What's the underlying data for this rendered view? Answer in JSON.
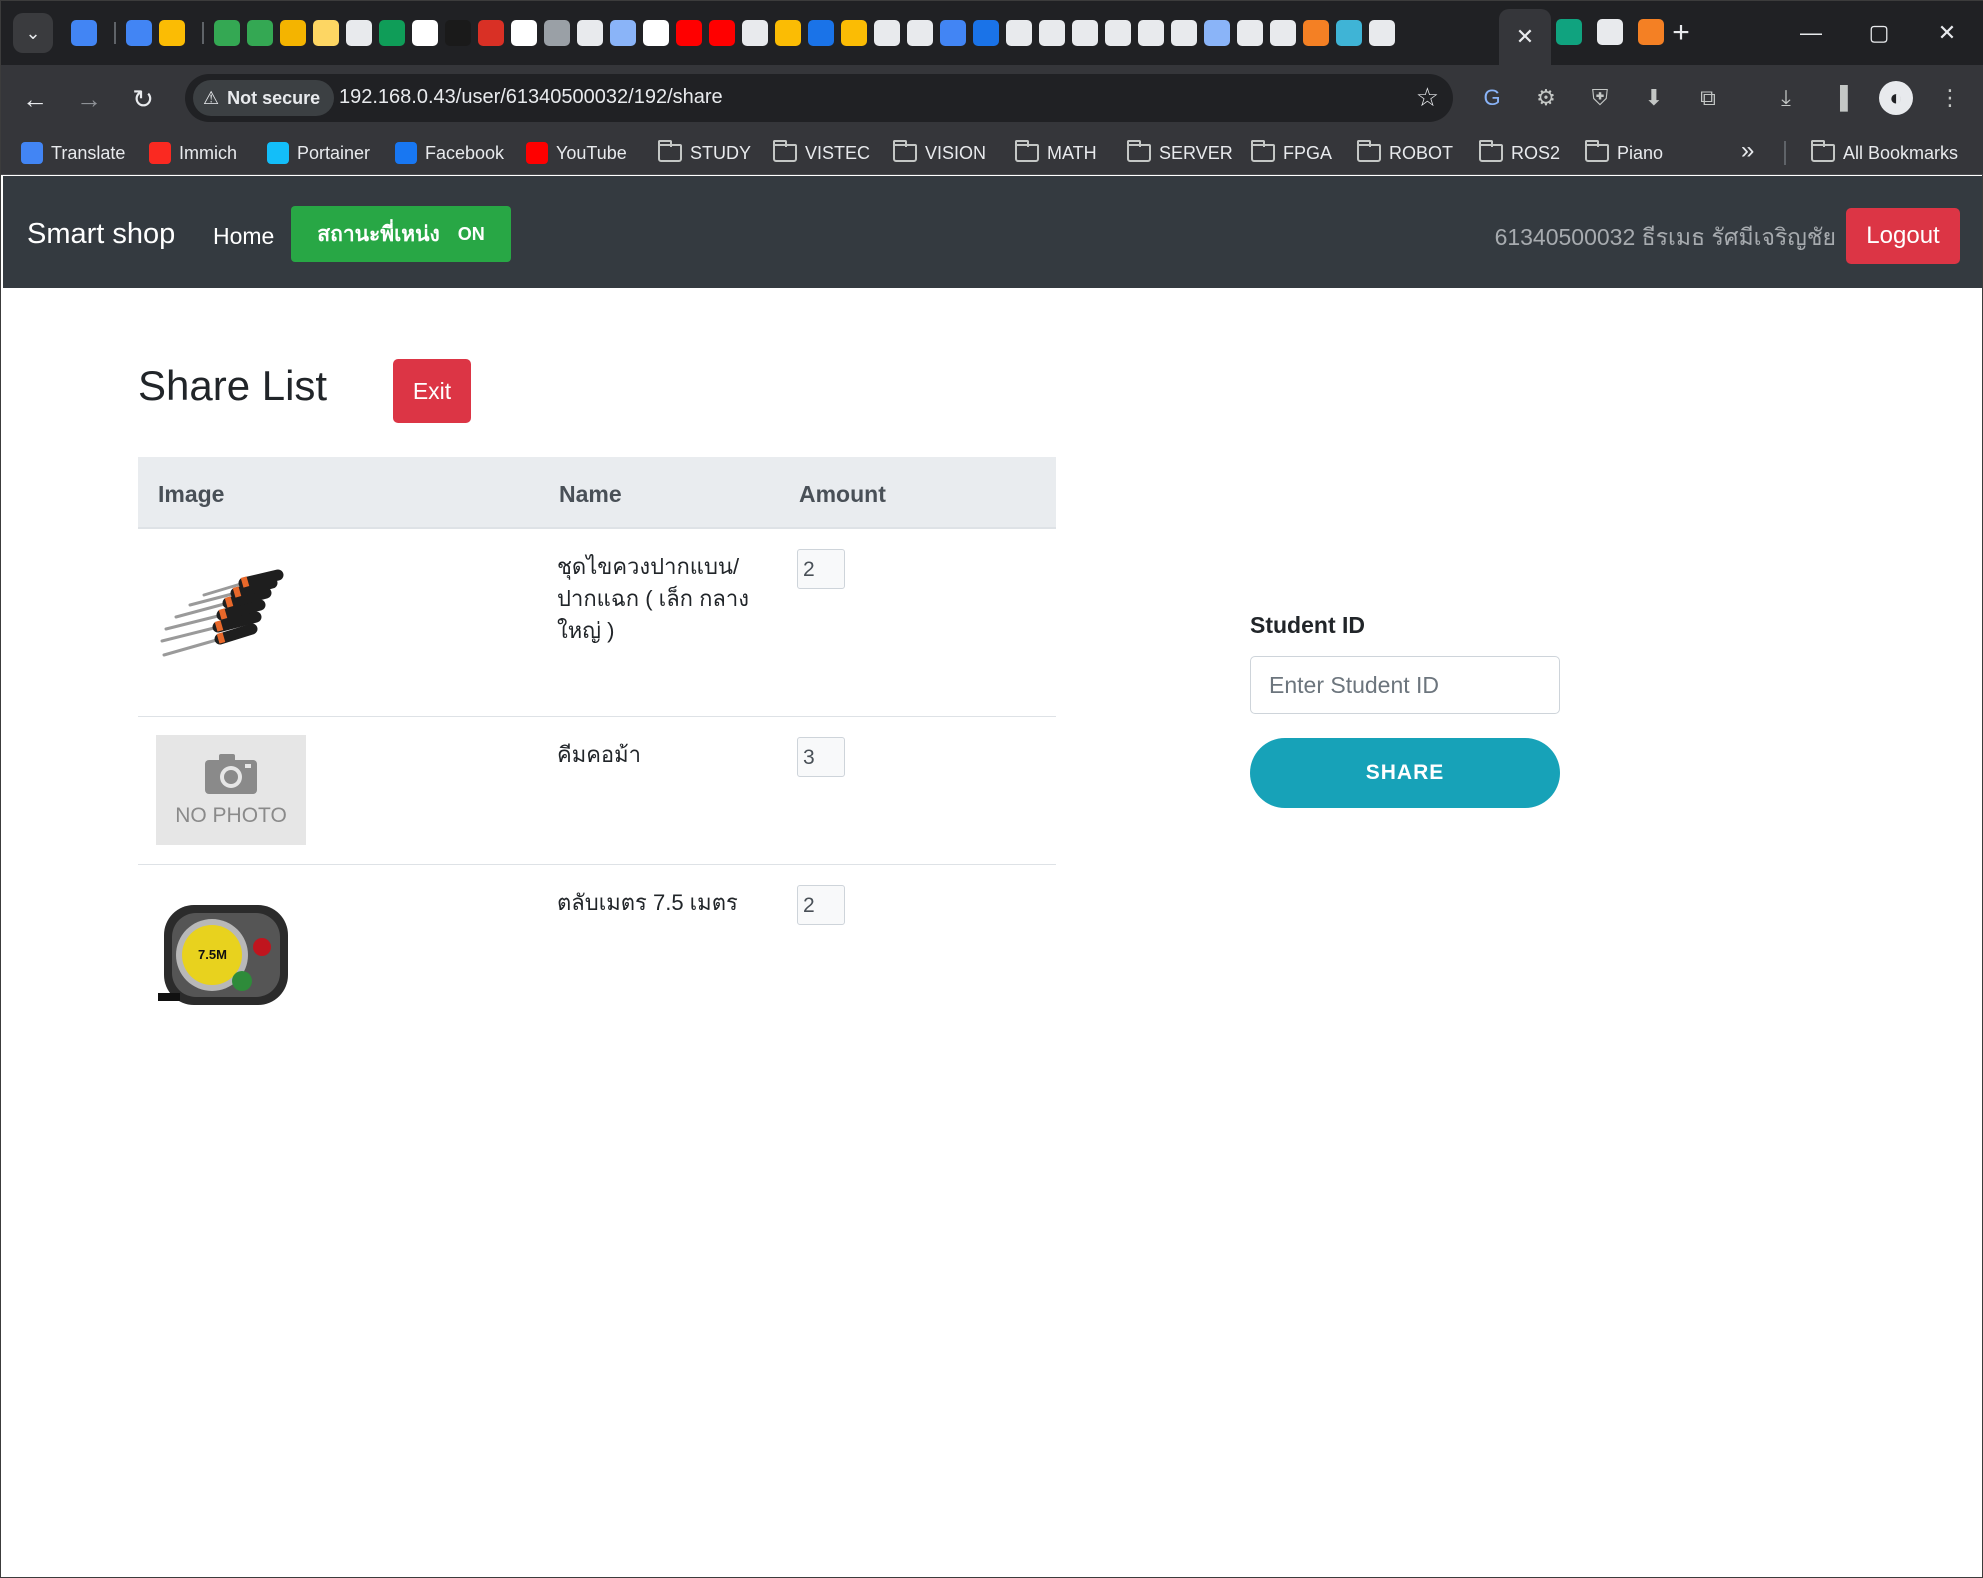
{
  "browser": {
    "active_tab_close": "✕",
    "new_tab": "+",
    "win_minimize": "—",
    "win_maximize": "▢",
    "win_close": "✕",
    "security_label": "Not secure",
    "url": "192.168.0.43/user/61340500032/192/share",
    "tab_favicon_colors": [
      "#4285f4",
      "#4285f4",
      "#fbbc04",
      "#34a853",
      "#34a853",
      "#f4b400",
      "#fdd663",
      "#e8eaed",
      "#0f9d58",
      "#ffffff",
      "#1a1a1a",
      "#d93025",
      "#ffffff",
      "#9aa0a6",
      "#e8eaed",
      "#8ab4f8",
      "#ffffff",
      "#ff0000",
      "#ff0000",
      "#e8eaed",
      "#fbbc04",
      "#1a73e8",
      "#fbbc04",
      "#e8eaed",
      "#e8eaed",
      "#4285f4",
      "#1a73e8",
      "#e8eaed",
      "#e8eaed",
      "#e8eaed",
      "#e8eaed",
      "#e8eaed",
      "#e8eaed",
      "#8ab4f8",
      "#e8eaed",
      "#e8eaed",
      "#f48024",
      "#3fb4d6",
      "#e8eaed"
    ]
  },
  "bookmarks": {
    "items": [
      {
        "label": "Translate",
        "type": "app",
        "color": "#4285f4"
      },
      {
        "label": "Immich",
        "type": "app",
        "color": "#fa2921"
      },
      {
        "label": "Portainer",
        "type": "app",
        "color": "#13bef9"
      },
      {
        "label": "Facebook",
        "type": "app",
        "color": "#1877f2"
      },
      {
        "label": "YouTube",
        "type": "app",
        "color": "#ff0000"
      },
      {
        "label": "STUDY",
        "type": "folder"
      },
      {
        "label": "VISTEC",
        "type": "folder"
      },
      {
        "label": "VISION",
        "type": "folder"
      },
      {
        "label": "MATH",
        "type": "folder"
      },
      {
        "label": "SERVER",
        "type": "folder"
      },
      {
        "label": "FPGA",
        "type": "folder"
      },
      {
        "label": "ROBOT",
        "type": "folder"
      },
      {
        "label": "ROS2",
        "type": "folder"
      },
      {
        "label": "Piano",
        "type": "folder"
      }
    ],
    "more": "»",
    "all_bookmarks": "All Bookmarks"
  },
  "navbar": {
    "brand": "Smart shop",
    "home": "Home",
    "status_label": "สถานะพี่เหน่ง",
    "status_value": "ON",
    "user": "61340500032 ธีรเมธ รัศมีเจริญชัย",
    "logout": "Logout"
  },
  "share": {
    "title": "Share List",
    "exit": "Exit",
    "columns": [
      "Image",
      "Name",
      "Amount"
    ],
    "rows": [
      {
        "name": "ชุดไขควงปากแบน/ปากแฉก ( เล็ก กลาง ใหญ่ )",
        "amount": "2",
        "image": "screwdriver-set"
      },
      {
        "name": "คีมคอม้า",
        "amount": "3",
        "image": "no-photo"
      },
      {
        "name": "ตลับเมตร 7.5 เมตร",
        "amount": "2",
        "image": "tape-measure"
      }
    ],
    "no_photo_text": "NO PHOTO",
    "tape_label": "7.5M"
  },
  "form": {
    "student_id_label": "Student ID",
    "student_id_placeholder": "Enter Student ID",
    "student_id_value": "",
    "share_button": "SHARE"
  }
}
